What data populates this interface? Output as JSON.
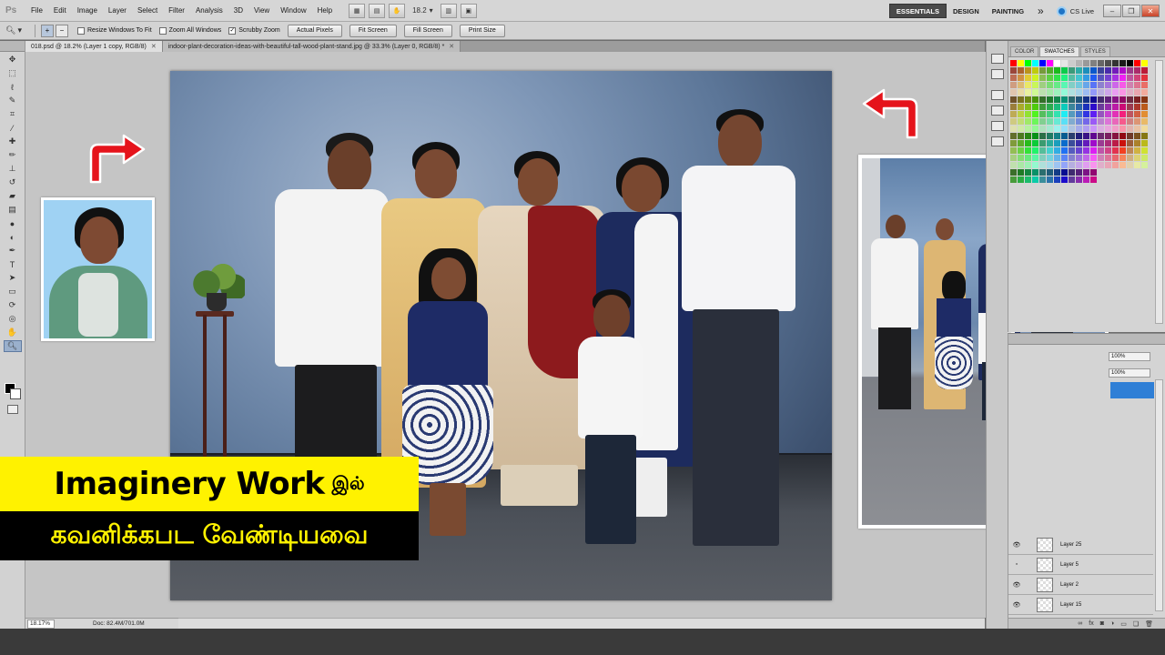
{
  "app": {
    "logo": "Ps",
    "menus": [
      "File",
      "Edit",
      "Image",
      "Layer",
      "Select",
      "Filter",
      "Analysis",
      "3D",
      "View",
      "Window",
      "Help"
    ],
    "toolbar_zoom": "18.2",
    "workspaces": [
      "ESSENTIALS",
      "DESIGN",
      "PAINTING"
    ],
    "more": "»",
    "cs_live": "CS Live"
  },
  "options": {
    "resize_windows": "Resize Windows To Fit",
    "zoom_all": "Zoom All Windows",
    "scrubby_zoom": "Scrubby Zoom",
    "buttons": [
      "Actual Pixels",
      "Fit Screen",
      "Fill Screen",
      "Print Size"
    ]
  },
  "tabs": [
    {
      "label": "018.psd @ 18.2% (Layer 1 copy, RGB/8)"
    },
    {
      "label": "indoor-plant-decoration-ideas-with-beautiful-tall-wood-plant-stand.jpg @ 33.3% (Layer 0, RGB/8) *"
    }
  ],
  "status": {
    "zoom": "18.17%",
    "doc": "Doc: 82.4M/701.0M"
  },
  "banner": {
    "line1_en": "Imaginery Work",
    "line1_ta": "இல்",
    "line2": "கவனிக்கபட வேண்டியவை"
  },
  "panels": {
    "swatch_tabs": [
      "COLOR",
      "SWATCHES",
      "STYLES"
    ],
    "zoom_fields": [
      "100%",
      "100%"
    ],
    "layers": [
      {
        "name": "Layer 25",
        "visible": true
      },
      {
        "name": "Layer 5",
        "visible": false
      },
      {
        "name": "Layer 2",
        "visible": true
      },
      {
        "name": "Layer 15",
        "visible": true
      }
    ],
    "footer_icons": [
      "link-icon",
      "fx-icon",
      "mask-icon",
      "adjustment-icon",
      "group-icon",
      "new-layer-icon",
      "trash-icon"
    ]
  },
  "colors": {
    "banner_yellow": "#fff200",
    "layer_select": "#2f7fd6",
    "arrow_red": "#e5131b"
  }
}
